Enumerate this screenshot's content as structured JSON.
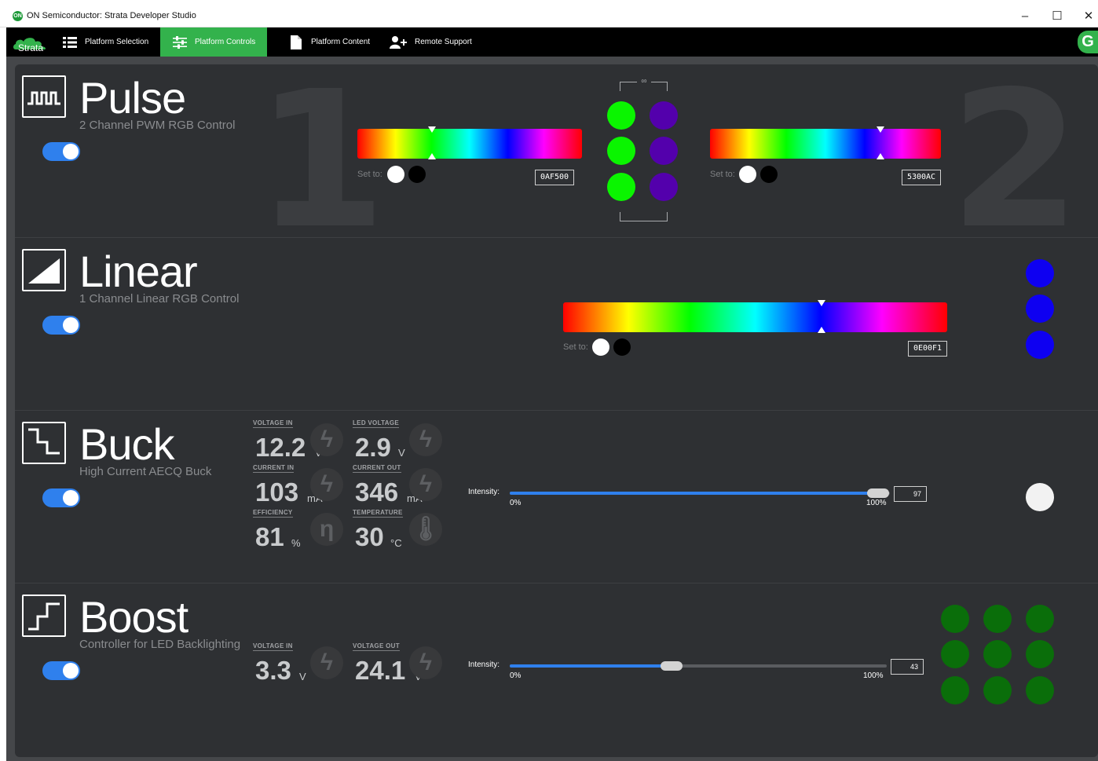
{
  "window": {
    "title": "ON Semiconductor: Strata Developer Studio",
    "app_badge": "ON"
  },
  "nav": {
    "logo": "Strata",
    "tabs": [
      {
        "label": "Platform Selection",
        "icon": "list-icon"
      },
      {
        "label": "Platform Controls",
        "icon": "sliders-icon"
      },
      {
        "label": "Platform Content",
        "icon": "document-icon"
      },
      {
        "label": "Remote Support",
        "icon": "add-user-icon"
      }
    ],
    "user_initial": "G",
    "accent": "#33b24c"
  },
  "pulse": {
    "title": "Pulse",
    "subtitle": "2 Channel PWM RGB Control",
    "enabled": true,
    "channel1": {
      "number": "1",
      "set_to": "Set to:",
      "hex": "0AF500",
      "color": "#0AF500",
      "hue_fraction": 0.33
    },
    "channel2": {
      "number": "2",
      "set_to": "Set to:",
      "hex": "5300AC",
      "color": "#5300AC",
      "hue_fraction": 0.75
    },
    "leds_left_color": "#0AF500",
    "leds_right_color": "#5300AC"
  },
  "linear": {
    "title": "Linear",
    "subtitle": "1 Channel Linear RGB Control",
    "enabled": true,
    "set_to": "Set to:",
    "hex": "0E00F1",
    "color": "#0E00F1",
    "hue_fraction": 0.67
  },
  "buck": {
    "title": "Buck",
    "subtitle": "High Current AECQ Buck",
    "enabled": true,
    "stats": [
      {
        "label": "VOLTAGE IN",
        "value": "12.2",
        "unit": "V",
        "icon": "bolt-icon"
      },
      {
        "label": "LED VOLTAGE",
        "value": "2.9",
        "unit": "V",
        "icon": "bolt-icon"
      },
      {
        "label": "CURRENT IN",
        "value": "103",
        "unit": "mA",
        "icon": "bolt-icon"
      },
      {
        "label": "CURRENT OUT",
        "value": "346",
        "unit": "mA",
        "icon": "bolt-icon"
      },
      {
        "label": "EFFICIENCY",
        "value": "81",
        "unit": "%",
        "icon": "eta-icon"
      },
      {
        "label": "TEMPERATURE",
        "value": "30",
        "unit": "°C",
        "icon": "thermometer-icon"
      }
    ],
    "intensity": {
      "label": "Intensity:",
      "min_label": "0%",
      "max_label": "100%",
      "value": "97",
      "fraction": 0.97
    },
    "led_color": "#f2f2f2"
  },
  "boost": {
    "title": "Boost",
    "subtitle": "Controller for LED Backlighting",
    "enabled": true,
    "stats": [
      {
        "label": "VOLTAGE IN",
        "value": "3.3",
        "unit": "V",
        "icon": "bolt-icon"
      },
      {
        "label": "VOLTAGE OUT",
        "value": "24.1",
        "unit": "V",
        "icon": "bolt-icon"
      }
    ],
    "intensity": {
      "label": "Intensity:",
      "min_label": "0%",
      "max_label": "100%",
      "value": "43",
      "fraction": 0.43
    },
    "led_color": "#0a6e0a"
  }
}
